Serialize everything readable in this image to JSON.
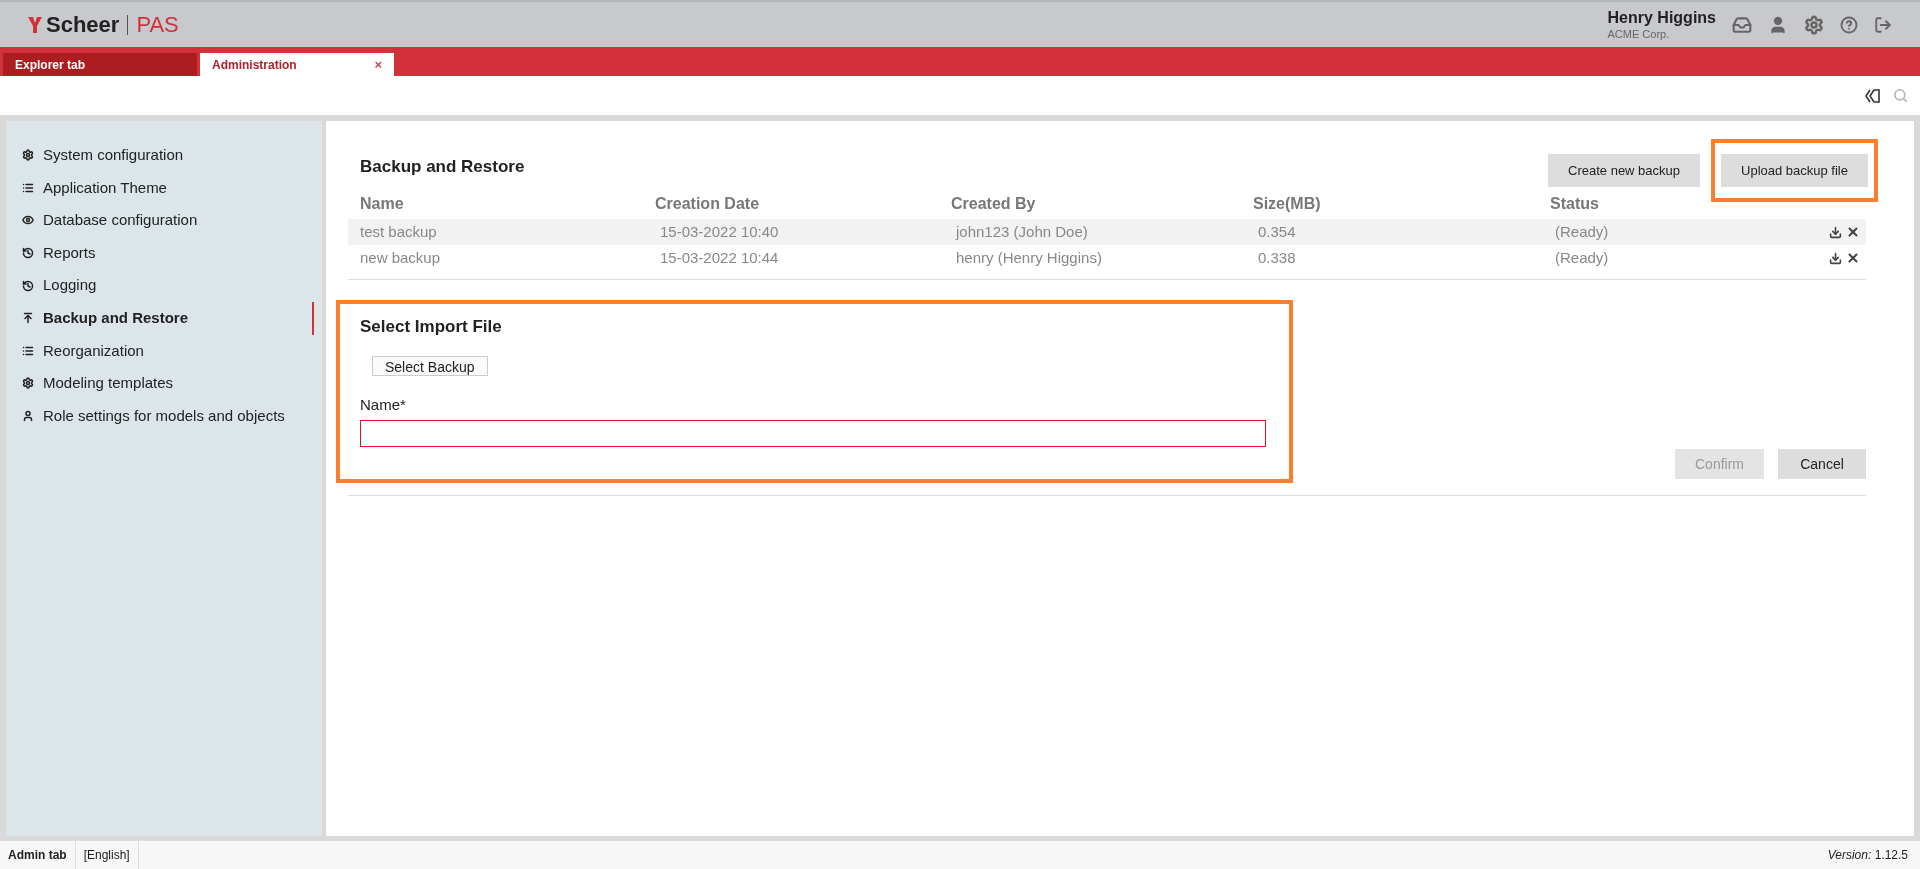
{
  "header": {
    "logo": {
      "brand": "Scheer",
      "product": "PAS"
    },
    "user": {
      "name": "Henry Higgins",
      "company": "ACME Corp."
    }
  },
  "tabs": [
    {
      "label": "Explorer tab",
      "selected": false
    },
    {
      "label": "Administration",
      "selected": true,
      "close": "×"
    }
  ],
  "sidebar": {
    "items": [
      {
        "label": "System configuration",
        "kind": "gear",
        "selected": false
      },
      {
        "label": "Application Theme",
        "kind": "list",
        "selected": false
      },
      {
        "label": "Database configuration",
        "kind": "eye",
        "selected": false
      },
      {
        "label": "Reports",
        "kind": "history",
        "selected": false
      },
      {
        "label": "Logging",
        "kind": "history",
        "selected": false
      },
      {
        "label": "Backup and Restore",
        "kind": "upload",
        "selected": true
      },
      {
        "label": "Reorganization",
        "kind": "list",
        "selected": false
      },
      {
        "label": "Modeling templates",
        "kind": "gear",
        "selected": false
      },
      {
        "label": "Role settings for models and objects",
        "kind": "user",
        "selected": false
      }
    ]
  },
  "backup": {
    "title": "Backup and Restore",
    "buttons": [
      {
        "label": "Create new backup",
        "highlighted": false
      },
      {
        "label": "Upload backup file",
        "highlighted": true
      }
    ],
    "table": {
      "columns": [
        "Name",
        "Creation Date",
        "Created By",
        "Size(MB)",
        "Status"
      ],
      "rows": [
        [
          "test backup",
          "15-03-2022 10:40",
          "john123 (John Doe)",
          "0.354",
          "(Ready)"
        ],
        [
          "new backup",
          "15-03-2022 10:44",
          "henry (Henry Higgins)",
          "0.338",
          "(Ready)"
        ]
      ]
    }
  },
  "import": {
    "title": "Select Import File",
    "highlighted": true,
    "select_button": "Select Backup",
    "field_label": "Name*",
    "invalid": true,
    "buttons": [
      {
        "label": "Confirm",
        "disabled": true
      },
      {
        "label": "Cancel",
        "disabled": false
      }
    ]
  },
  "status_bar": {
    "tab": "Admin tab",
    "language": "[English]",
    "version_label": "Version:",
    "version": "1.12.5"
  }
}
